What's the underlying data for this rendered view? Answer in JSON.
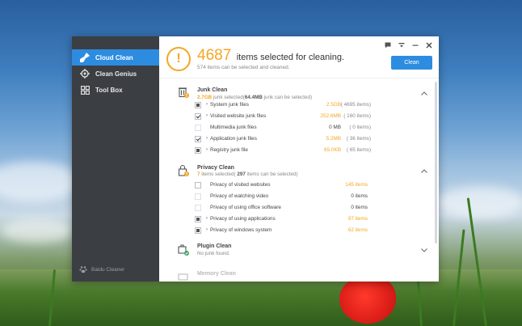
{
  "sidebar": {
    "items": [
      {
        "label": "Cloud Clean",
        "icon": "broom-icon",
        "active": true
      },
      {
        "label": "Clean Genius",
        "icon": "gear-icon",
        "active": false
      },
      {
        "label": "Tool Box",
        "icon": "grid-icon",
        "active": false
      }
    ],
    "footer": "Baidu Cleaner"
  },
  "header": {
    "count": "4687",
    "headline": "items selected for cleaning.",
    "subline": "574 items can be selected and cleaned.",
    "clean_label": "Clean"
  },
  "sections": {
    "junk": {
      "title": "Junk Clean",
      "sub_value": "2.7GB",
      "sub_mid": " junk selected(",
      "sub_value2": "64.4MB",
      "sub_end": " junk can be selected)",
      "rows": [
        {
          "label": "System junk files",
          "size": "2.5GB",
          "count": "( 4695 items)",
          "state": "partial",
          "size_orange": true
        },
        {
          "label": "Visited website junk files",
          "size": "252.6MB",
          "count": "( 160 items)",
          "state": "checked",
          "size_orange": true
        },
        {
          "label": "Multimedia junk files",
          "size": "0 MB",
          "count": "( 0 items)",
          "state": "disabled",
          "size_orange": false
        },
        {
          "label": "Application junk files",
          "size": "5.2MB",
          "count": "( 36 items)",
          "state": "checked",
          "size_orange": true
        },
        {
          "label": "Registry junk file",
          "size": "65.0KB",
          "count": "( 65 items)",
          "state": "partial",
          "size_orange": true
        }
      ]
    },
    "privacy": {
      "title": "Privacy Clean",
      "sub_value": "7",
      "sub_mid": " items selected( ",
      "sub_value2": "297",
      "sub_end": " items can be selected)",
      "rows": [
        {
          "label": "Privacy of visited websites",
          "items": "145 items",
          "state": "unchecked",
          "orange": true
        },
        {
          "label": "Privacy of watching video",
          "items": "0 items",
          "state": "disabled",
          "orange": false
        },
        {
          "label": "Privacy of using office software",
          "items": "0 items",
          "state": "disabled",
          "orange": false
        },
        {
          "label": "Privacy of using applications",
          "items": "97 items",
          "state": "partial",
          "orange": true
        },
        {
          "label": "Privacy of windows system",
          "items": "62 items",
          "state": "partial",
          "orange": true
        }
      ]
    },
    "plugin": {
      "title": "Plugin Clean",
      "sub": "No junk found."
    },
    "memory": {
      "title": "Memory Clean"
    }
  },
  "colors": {
    "accent": "#2d8ce0",
    "warning": "#f5a623",
    "sidebar": "#3b3e43"
  }
}
